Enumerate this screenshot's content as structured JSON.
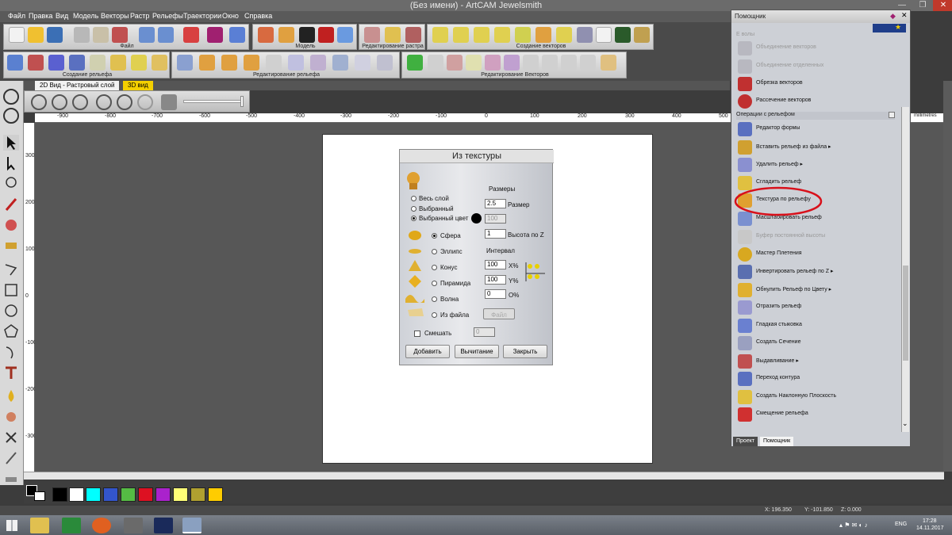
{
  "window": {
    "title": "(Без имени) - ArtCAM Jewelsmith"
  },
  "menu": [
    "Файл",
    "Правка",
    "Вид",
    "Модель",
    "Векторы",
    "Растр",
    "Рельефы",
    "Траектории",
    "Окно",
    "Справка"
  ],
  "toolbar_groups": {
    "file": "Файл",
    "model": "Модель",
    "raster_edit": "Редактирование растра",
    "vector_create": "Создание векторов",
    "relief_create": "Создание рельефа",
    "relief_edit": "Редактирование рельефа",
    "vector_edit": "Редактирование Векторов"
  },
  "tabs": [
    {
      "label": "2D Вид - Растровый слой"
    },
    {
      "label": "3D вид"
    }
  ],
  "ruler": {
    "h_ticks": [
      "-900",
      "-800",
      "-700",
      "-600",
      "-500",
      "-400",
      "-300",
      "-200",
      "-100",
      "0",
      "100",
      "200",
      "300",
      "400",
      "500"
    ],
    "v_ticks": [
      "300",
      "200",
      "100",
      "0",
      "-100",
      "-200",
      "-300"
    ],
    "unit": "millimetres"
  },
  "dialog": {
    "title": "Из текстуры",
    "sizes_header": "Размеры",
    "radio_whole_layer": "Весь слой",
    "radio_selected": "Выбранный",
    "radio_selected_color": "Выбранный цвет",
    "size_value": "2.5",
    "size_label": "Размер",
    "disabled_value_1": "100",
    "height_value": "1",
    "height_label": "Высота по Z",
    "interval_header": "Интервал",
    "shapes": [
      "Сфера",
      "Эллипс",
      "Конус",
      "Пирамида",
      "Волна",
      "Из файла"
    ],
    "x_value": "100",
    "x_label": "X%",
    "y_value": "100",
    "y_label": "Y%",
    "o_value": "0",
    "o_label": "O%",
    "file_button": "Файл",
    "mix_label": "Смешать",
    "mix_value": "0",
    "add_button": "Добавить",
    "subtract_button": "Вычитание",
    "close_button": "Закрыть"
  },
  "palette": [
    "#000000",
    "#ffffff",
    "#00ffff",
    "#3355cc",
    "#55bb44",
    "#dd1122",
    "#aa22cc",
    "#ffff77",
    "#b0a030",
    "#ffcc00"
  ],
  "status": {
    "x": "X: 196.350",
    "y": "Y: -101.850",
    "z": "Z: 0.000"
  },
  "taskbar": {
    "lang": "ENG",
    "time": "17:28",
    "date": "14.11.2017"
  },
  "helper": {
    "title": "Помощник",
    "section_top_dim": "Е волы",
    "items_top": [
      {
        "label": "Объединение векторов",
        "dim": true
      },
      {
        "label": "Объединение отделенных",
        "dim": true
      },
      {
        "label": "Обрезка векторов",
        "dim": false
      },
      {
        "label": "Рассечение векторов",
        "dim": false
      }
    ],
    "section": "Операции с рельефом",
    "items": [
      {
        "label": "Редактор формы",
        "dim": false
      },
      {
        "label": "Вставить рельеф из файла ▸",
        "dim": false
      },
      {
        "label": "Удалить рельеф ▸",
        "dim": false
      },
      {
        "label": "Сгладить рельеф",
        "dim": false
      },
      {
        "label": "Текстура по рельефу",
        "dim": false
      },
      {
        "label": "Масштабировать рельеф",
        "dim": false
      },
      {
        "label": "Буфер постоянной высоты",
        "dim": true
      },
      {
        "label": "Мастер Плетения",
        "dim": false
      },
      {
        "label": "Инвертировать рельеф по Z ▸",
        "dim": false
      },
      {
        "label": "Обнулить Рельеф по Цвету ▸",
        "dim": false
      },
      {
        "label": "Отразить рельеф",
        "dim": false
      },
      {
        "label": "Гладкая стыковка",
        "dim": false
      },
      {
        "label": "Создать Сечение",
        "dim": false
      },
      {
        "label": "Выдавливание ▸",
        "dim": false
      },
      {
        "label": "Переход контура",
        "dim": false
      },
      {
        "label": "Создать Наклонную Плоскость",
        "dim": false
      },
      {
        "label": "Смещение рельефа",
        "dim": false
      }
    ],
    "tab_project": "Проект",
    "tab_helper": "Помощник"
  },
  "colors": {
    "highlight_ring": "#d8101a",
    "accent_tab": "#f4d000"
  }
}
